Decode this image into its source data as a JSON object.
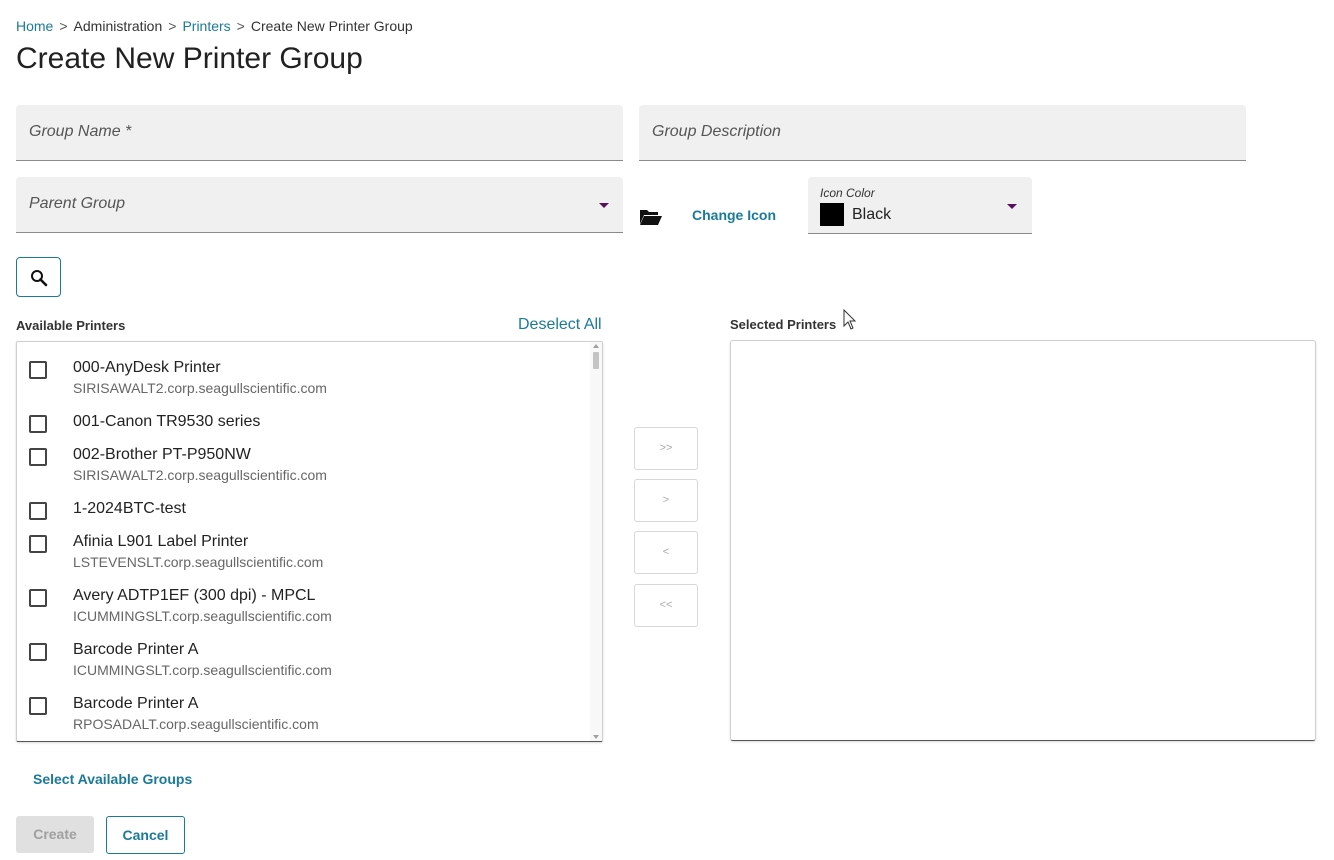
{
  "breadcrumb": {
    "home": "Home",
    "sep1": ">",
    "administration": "Administration",
    "sep2": ">",
    "printers": "Printers",
    "sep3": ">",
    "current": "Create New Printer Group"
  },
  "title": "Create New Printer Group",
  "form": {
    "group_name_placeholder": "Group Name *",
    "group_description_placeholder": "Group Description",
    "parent_group_placeholder": "Parent Group",
    "change_icon_label": "Change Icon",
    "icon_color_label": "Icon Color",
    "icon_color_value": "Black",
    "icon_color_hex": "#000000"
  },
  "icons": {
    "search": "search-icon",
    "folder": "folder-open-icon",
    "dropdown": "chevron-down-icon"
  },
  "available": {
    "label": "Available Printers",
    "deselect_all": "Deselect All",
    "items": [
      {
        "name": "000-AnyDesk Printer",
        "host": "SIRISAWALT2.corp.seagullscientific.com"
      },
      {
        "name": "001-Canon TR9530 series",
        "host": ""
      },
      {
        "name": "002-Brother PT-P950NW",
        "host": "SIRISAWALT2.corp.seagullscientific.com"
      },
      {
        "name": "1-2024BTC-test",
        "host": ""
      },
      {
        "name": "Afinia L901 Label Printer",
        "host": "LSTEVENSLT.corp.seagullscientific.com"
      },
      {
        "name": "Avery ADTP1EF (300 dpi) - MPCL",
        "host": "ICUMMINGSLT.corp.seagullscientific.com"
      },
      {
        "name": "Barcode Printer A",
        "host": "ICUMMINGSLT.corp.seagullscientific.com"
      },
      {
        "name": "Barcode Printer A",
        "host": "RPOSADALT.corp.seagullscientific.com"
      }
    ]
  },
  "transfer": {
    "add_all": ">>",
    "add": ">",
    "remove": "<",
    "remove_all": "<<"
  },
  "selected": {
    "label": "Selected Printers"
  },
  "select_available_groups": "Select Available Groups",
  "buttons": {
    "create": "Create",
    "cancel": "Cancel"
  },
  "colors": {
    "link": "#1a7a9a",
    "field_bg": "#f0f0f0",
    "dropdown_caret": "#5a0f5a"
  }
}
